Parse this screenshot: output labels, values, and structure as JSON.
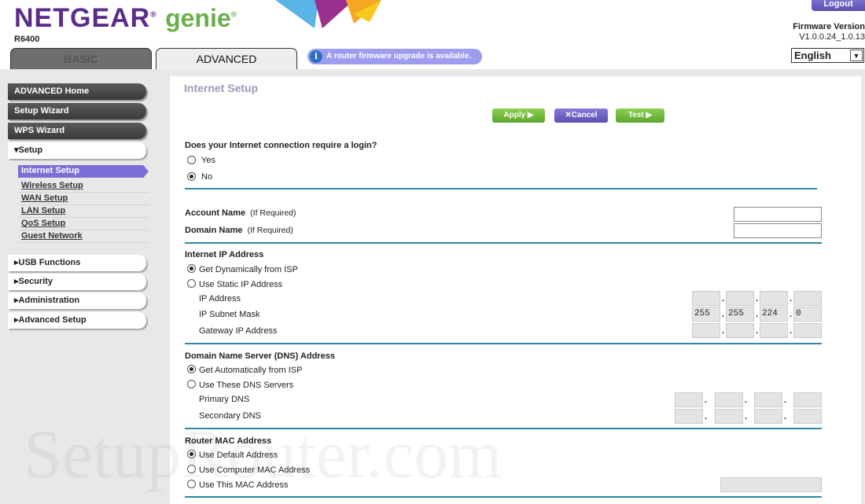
{
  "header": {
    "logo_brand": "NETGEAR",
    "logo_product": "genie",
    "model": "R6400",
    "tabs": [
      {
        "label": "BASIC"
      },
      {
        "label": "ADVANCED"
      }
    ],
    "notice": "A router firmware upgrade is available.",
    "logout": "Logout",
    "firmware_label": "Firmware Version",
    "firmware_version": "V1.0.0.24_1.0.13",
    "language": "English"
  },
  "sidebar": {
    "items": [
      {
        "label": "ADVANCED Home"
      },
      {
        "label": "Setup Wizard"
      },
      {
        "label": "WPS Wizard"
      },
      {
        "label": "Setup"
      }
    ],
    "setup_sub": [
      {
        "label": "Internet Setup"
      },
      {
        "label": "Wireless Setup"
      },
      {
        "label": "WAN Setup"
      },
      {
        "label": "LAN Setup"
      },
      {
        "label": "QoS Setup"
      },
      {
        "label": "Guest Network"
      }
    ],
    "collapsed": [
      {
        "label": "USB Functions"
      },
      {
        "label": "Security"
      },
      {
        "label": "Administration"
      },
      {
        "label": "Advanced Setup"
      }
    ]
  },
  "main": {
    "title": "Internet Setup",
    "buttons": {
      "apply": "Apply ▶",
      "cancel": "Cancel",
      "test": "Test ▶"
    },
    "login_question": "Does your Internet connection require a login?",
    "login_yes": "Yes",
    "login_no": "No",
    "login_selected": "No",
    "account_name": "Account Name",
    "domain_name": "Domain Name",
    "if_required": "(If Required)",
    "account_value": "",
    "domain_value": "",
    "ip_heading": "Internet IP Address",
    "ip_dynamic": "Get Dynamically from ISP",
    "ip_static": "Use Static IP Address",
    "ip_selected": "Get Dynamically from ISP",
    "ip_address": "IP Address",
    "subnet": "IP Subnet Mask",
    "gateway": "Gateway IP Address",
    "subnet_values": [
      "255",
      "255",
      "224",
      "0"
    ],
    "dns_heading": "Domain Name Server (DNS) Address",
    "dns_auto": "Get Automatically from ISP",
    "dns_manual": "Use These DNS Servers",
    "dns_selected": "Get Automatically from ISP",
    "primary_dns": "Primary DNS",
    "secondary_dns": "Secondary DNS",
    "mac_heading": "Router MAC Address",
    "mac_default": "Use Default Address",
    "mac_computer": "Use Computer MAC Address",
    "mac_this": "Use This MAC Address",
    "mac_selected": "Use Default Address"
  },
  "watermark": "SetupRouter.com",
  "colors": {
    "brand_purple": "#5b2d8a",
    "brand_green": "#6ab04c",
    "accent": "#7b6fd6",
    "divider": "#2c8aa5"
  }
}
